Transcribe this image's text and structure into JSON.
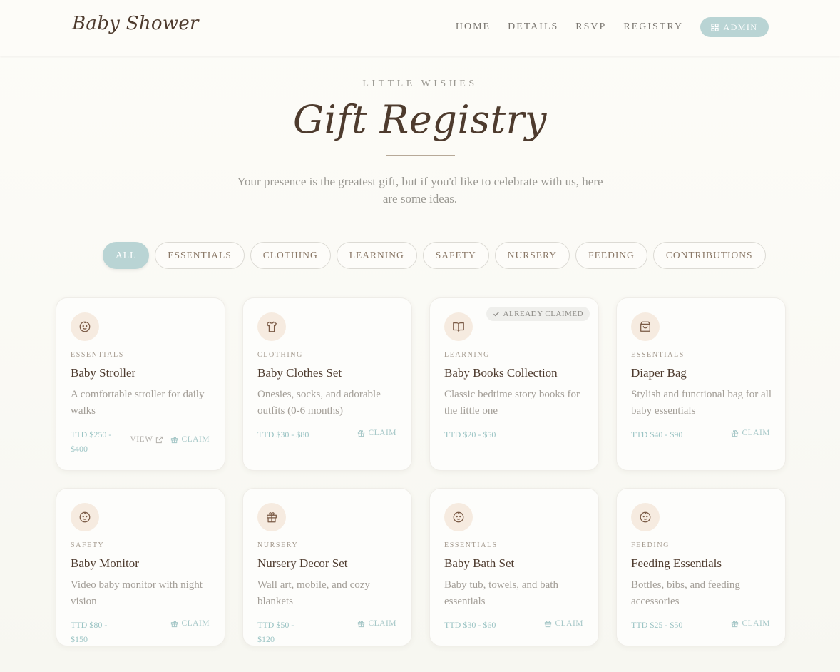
{
  "brand": "Baby Shower",
  "nav": {
    "home": "HOME",
    "details": "DETAILS",
    "rsvp": "RSVP",
    "registry": "REGISTRY",
    "admin": "ADMIN"
  },
  "hero": {
    "eyebrow": "LITTLE WISHES",
    "title": "Gift Registry",
    "subtitle": "Your presence is the greatest gift, but if you'd like to celebrate with us, here are some ideas."
  },
  "filters": [
    "ALL",
    "ESSENTIALS",
    "CLOTHING",
    "LEARNING",
    "SAFETY",
    "NURSERY",
    "FEEDING",
    "CONTRIBUTIONS"
  ],
  "active_filter": "ALL",
  "colors": {
    "accent": "#b9d4d4",
    "brown": "#4e3b2e",
    "icon_bg": "#f6ebe0",
    "price": "#9bc4c4"
  },
  "labels": {
    "claim": "CLAIM",
    "view": "VIEW",
    "already_claimed": "ALREADY CLAIMED"
  },
  "gifts": [
    {
      "icon": "baby-face-icon",
      "category": "ESSENTIALS",
      "title": "Baby Stroller",
      "description": "A comfortable stroller for daily walks",
      "price": "TTD $250 - $400",
      "has_view": true,
      "claimed": false
    },
    {
      "icon": "shirt-icon",
      "category": "CLOTHING",
      "title": "Baby Clothes Set",
      "description": "Onesies, socks, and adorable outfits (0-6 months)",
      "price": "TTD $30 - $80",
      "has_view": false,
      "claimed": false
    },
    {
      "icon": "book-icon",
      "category": "LEARNING",
      "title": "Baby Books Collection",
      "description": "Classic bedtime story books for the little one",
      "price": "TTD $20 - $50",
      "has_view": false,
      "claimed": true
    },
    {
      "icon": "bag-icon",
      "category": "ESSENTIALS",
      "title": "Diaper Bag",
      "description": "Stylish and functional bag for all baby essentials",
      "price": "TTD $40 - $90",
      "has_view": false,
      "claimed": false
    },
    {
      "icon": "baby-face-icon",
      "category": "SAFETY",
      "title": "Baby Monitor",
      "description": "Video baby monitor with night vision",
      "price": "TTD $80 - $150",
      "has_view": false,
      "claimed": false
    },
    {
      "icon": "gift-icon",
      "category": "NURSERY",
      "title": "Nursery Decor Set",
      "description": "Wall art, mobile, and cozy blankets",
      "price": "TTD $50 - $120",
      "has_view": false,
      "claimed": false
    },
    {
      "icon": "baby-face-icon",
      "category": "ESSENTIALS",
      "title": "Baby Bath Set",
      "description": "Baby tub, towels, and bath essentials",
      "price": "TTD $30 - $60",
      "has_view": false,
      "claimed": false
    },
    {
      "icon": "baby-face-icon",
      "category": "FEEDING",
      "title": "Feeding Essentials",
      "description": "Bottles, bibs, and feeding accessories",
      "price": "TTD $25 - $50",
      "has_view": false,
      "claimed": false
    }
  ]
}
